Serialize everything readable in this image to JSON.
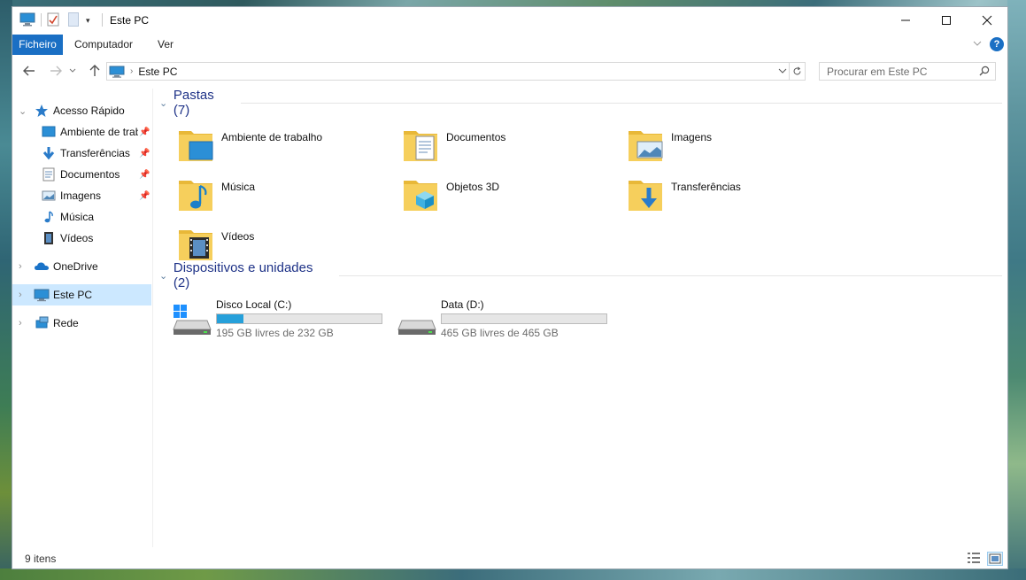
{
  "window": {
    "title": "Este PC"
  },
  "ribbon": {
    "tabs": [
      {
        "label": "Ficheiro",
        "active": true
      },
      {
        "label": "Computador",
        "active": false
      },
      {
        "label": "Ver",
        "active": false
      }
    ],
    "help_label": "?"
  },
  "address": {
    "path": "Este PC"
  },
  "search": {
    "placeholder": "Procurar em Este PC"
  },
  "nav": {
    "quick_access": "Acesso Rápido",
    "quick_items": [
      {
        "label": "Ambiente de trabalho",
        "icon": "desktop-icon",
        "pinned": true
      },
      {
        "label": "Transferências",
        "icon": "downloads-icon",
        "pinned": true
      },
      {
        "label": "Documentos",
        "icon": "documents-icon",
        "pinned": true
      },
      {
        "label": "Imagens",
        "icon": "pictures-icon",
        "pinned": true
      },
      {
        "label": "Música",
        "icon": "music-icon",
        "pinned": false
      },
      {
        "label": "Vídeos",
        "icon": "videos-icon",
        "pinned": false
      }
    ],
    "onedrive": "OneDrive",
    "thispc": "Este PC",
    "network": "Rede"
  },
  "folders_group": {
    "title": "Pastas (7)",
    "items": [
      {
        "label": "Ambiente de trabalho",
        "icon": "desktop-folder-icon"
      },
      {
        "label": "Documentos",
        "icon": "documents-folder-icon"
      },
      {
        "label": "Imagens",
        "icon": "pictures-folder-icon"
      },
      {
        "label": "Música",
        "icon": "music-folder-icon"
      },
      {
        "label": "Objetos 3D",
        "icon": "3d-objects-folder-icon"
      },
      {
        "label": "Transferências",
        "icon": "downloads-folder-icon"
      },
      {
        "label": "Vídeos",
        "icon": "videos-folder-icon"
      }
    ]
  },
  "drives_group": {
    "title": "Dispositivos e unidades (2)",
    "items": [
      {
        "name": "Disco Local (C:)",
        "free_text": "195 GB livres de 232 GB",
        "used_fraction": 0.16,
        "icon": "windows-drive-icon"
      },
      {
        "name": "Data (D:)",
        "free_text": "465 GB livres de 465 GB",
        "used_fraction": 0.0,
        "icon": "drive-icon"
      }
    ]
  },
  "status": {
    "item_count": "9 itens"
  },
  "colors": {
    "accent": "#1a6fc4",
    "selection": "#cce8ff",
    "group_title": "#1e3287",
    "drive_fill": "#26a0da",
    "folder": "#f4c84f"
  }
}
